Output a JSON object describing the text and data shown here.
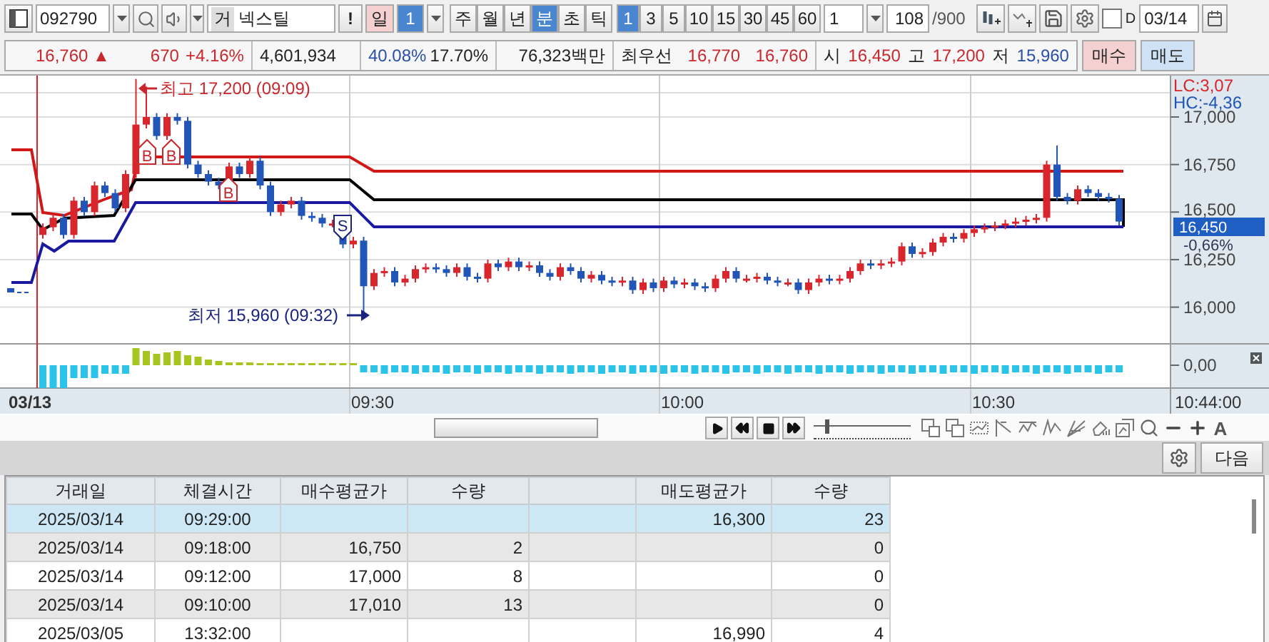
{
  "toolbar": {
    "code": "092790",
    "market_badge": "거",
    "stock_name": "넥스틸",
    "alert": "!",
    "day_button": "일",
    "day_count": "1",
    "periods": [
      {
        "label": "주",
        "selected": false
      },
      {
        "label": "월",
        "selected": false
      },
      {
        "label": "년",
        "selected": false
      },
      {
        "label": "분",
        "selected": true
      },
      {
        "label": "초",
        "selected": false
      },
      {
        "label": "틱",
        "selected": false
      }
    ],
    "intervals": [
      {
        "label": "1",
        "selected": true
      },
      {
        "label": "3",
        "selected": false
      },
      {
        "label": "5",
        "selected": false
      },
      {
        "label": "10",
        "selected": false
      },
      {
        "label": "15",
        "selected": false
      },
      {
        "label": "30",
        "selected": false
      },
      {
        "label": "45",
        "selected": false
      },
      {
        "label": "60",
        "selected": false
      }
    ],
    "unit": "1",
    "count": "108",
    "count_max": "/900",
    "d_option": {
      "label": "D",
      "checked": false
    },
    "date": "03/14"
  },
  "quote": {
    "price": "16,760",
    "change_sign": "▲",
    "change": "670",
    "change_rate": "+4.16%",
    "volume": "4,601,934",
    "ratio_1": "40.08%",
    "ratio_2": "17.70%",
    "amount": "76,323백만",
    "best_label": "최우선",
    "best_ask": "16,770",
    "best_bid": "16,760",
    "open_label": "시",
    "open": "16,450",
    "high_label": "고",
    "high": "17,200",
    "low_label": "저",
    "low": "15,960",
    "buy_button": "매수",
    "sell_button": "매도"
  },
  "chart": {
    "y_ticks": [
      "17,000",
      "16,750",
      "16,500",
      "16,250",
      "16,000"
    ],
    "lc": "LC:3,07",
    "hc": "HC:-4,36",
    "current_price": "16,450",
    "current_change": "-0,66%",
    "osc_tick": "0,00",
    "x_labels": [
      "03/13",
      "09:30",
      "10:00",
      "10:30"
    ],
    "x_end": "10:44:00",
    "high_note": "최고 17,200 (09:09)",
    "low_note": "최저 15,960 (09:32)",
    "markers": [
      {
        "label": "B",
        "kind": "buy"
      },
      {
        "label": "B",
        "kind": "buy"
      },
      {
        "label": "B",
        "kind": "buy"
      },
      {
        "label": "S",
        "kind": "sell"
      }
    ]
  },
  "playback": {
    "zoom_slider": {
      "level": 0.12
    }
  },
  "tools": {
    "font_button": "A"
  },
  "bottom_bar": {
    "next_button": "다음"
  },
  "table": {
    "columns": [
      "거래일",
      "체결시간",
      "매수평균가",
      "수량",
      null,
      "매도평균가",
      "수량"
    ],
    "rows": [
      {
        "selected": true,
        "cells": [
          "2025/03/14",
          "09:29:00",
          null,
          null,
          null,
          "16,300",
          "23"
        ]
      },
      {
        "selected": false,
        "cells": [
          "2025/03/14",
          "09:18:00",
          "16,750",
          "2",
          null,
          null,
          "0"
        ]
      },
      {
        "selected": false,
        "cells": [
          "2025/03/14",
          "09:12:00",
          "17,000",
          "8",
          null,
          null,
          "0"
        ]
      },
      {
        "selected": false,
        "cells": [
          "2025/03/14",
          "09:10:00",
          "17,010",
          "13",
          null,
          null,
          "0"
        ]
      },
      {
        "selected": false,
        "cells": [
          "2025/03/05",
          "13:32:00",
          null,
          null,
          null,
          "16,990",
          "4"
        ]
      }
    ]
  }
}
